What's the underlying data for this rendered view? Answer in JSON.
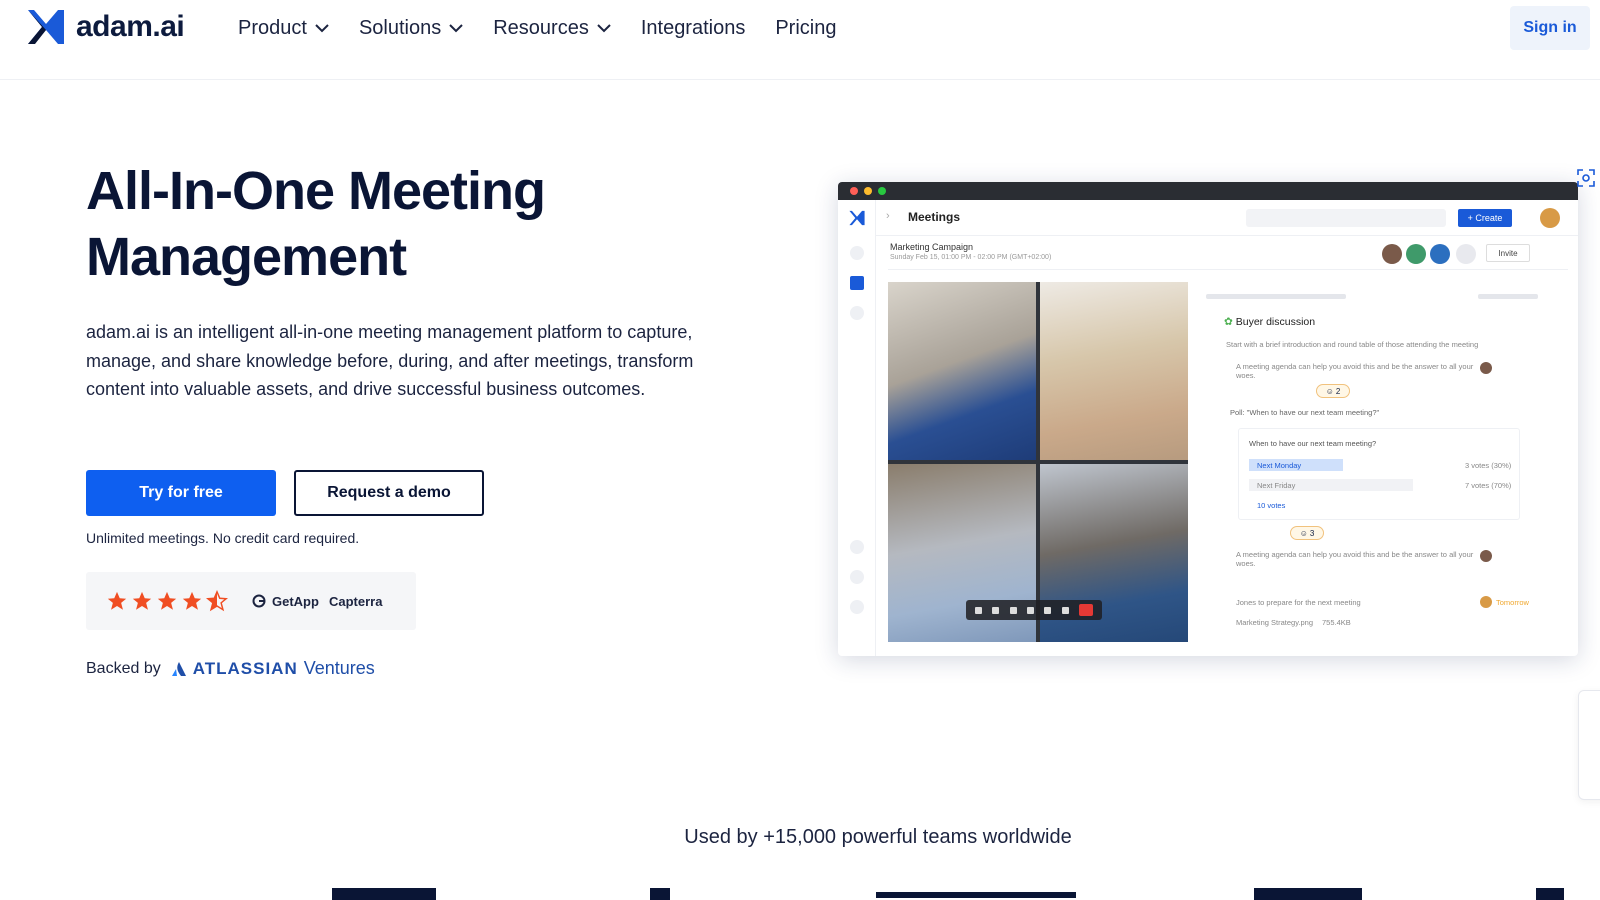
{
  "brand": {
    "name": "adam.ai"
  },
  "nav": {
    "items": [
      {
        "label": "Product",
        "dropdown": true
      },
      {
        "label": "Solutions",
        "dropdown": true
      },
      {
        "label": "Resources",
        "dropdown": true
      },
      {
        "label": "Integrations",
        "dropdown": false
      },
      {
        "label": "Pricing",
        "dropdown": false
      }
    ],
    "signin": "Sign in"
  },
  "hero": {
    "title_line1": "All-In-One Meeting",
    "title_line2": "Management",
    "description": "adam.ai is an intelligent all-in-one meeting management platform to capture, manage, and share knowledge before, during, and after meetings, transform content into valuable assets, and drive successful business outcomes.",
    "cta_primary": "Try for free",
    "cta_secondary": "Request a demo",
    "fine_print": "Unlimited meetings. No credit card required.",
    "rating": {
      "stars": 4.5,
      "max": 5,
      "sources": [
        "GetApp",
        "Capterra"
      ]
    },
    "backed_by": {
      "label": "Backed by",
      "name": "ATLASSIAN",
      "suffix": "Ventures"
    }
  },
  "mockup": {
    "header_title": "Meetings",
    "create_label": "+ Create",
    "meeting_title": "Marketing Campaign",
    "meeting_date": "Sunday Feb 15, 01:00 PM - 02:00 PM (GMT+02:00)",
    "invite_label": "Invite",
    "panel_heading": "Buyer discussion",
    "agenda_intro": "Start with a brief introduction and round table of those attending the meeting",
    "agenda_item": "A meeting agenda can help you avoid this and be the answer to all your woes.",
    "poll_title": "Poll: \"When to have our next team meeting?\"",
    "poll_question": "When to have our next team meeting?",
    "poll_options": [
      {
        "label": "Next Monday",
        "votes": "3 votes (30%)",
        "share": 0.3
      },
      {
        "label": "Next Friday",
        "votes": "7 votes (70%)",
        "share": 0.7
      }
    ],
    "poll_total": "10 votes",
    "reaction_count_1": "2",
    "reaction_count_2": "3",
    "task": "Jones to prepare for the next meeting",
    "task_due": "Tomorrow",
    "attachment": "Marketing Strategy.png",
    "attachment_size": "755.4KB",
    "colors": {
      "accent": "#1a5ad8",
      "end_call": "#e53935"
    }
  },
  "social_proof": {
    "text": "Used by +15,000 powerful teams worldwide"
  },
  "colors": {
    "primary": "#0e5ff0",
    "heading": "#0a1535",
    "star": "#f04e23"
  }
}
